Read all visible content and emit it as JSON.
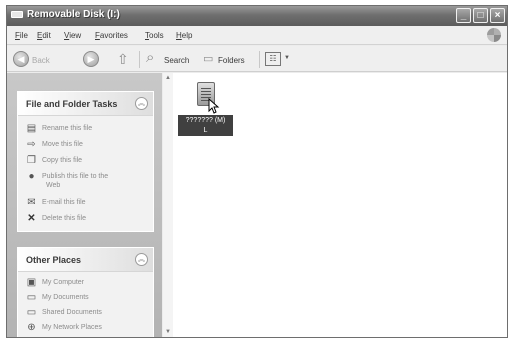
{
  "window": {
    "title": "Removable Disk (I:)"
  },
  "menu": [
    "File",
    "Edit",
    "View",
    "Favorites",
    "Tools",
    "Help"
  ],
  "toolbar": {
    "back": "Back",
    "search": "Search",
    "folders": "Folders"
  },
  "tasks_panel": {
    "title": "File and Folder Tasks",
    "items": [
      {
        "label": "Rename this file",
        "icon": "rename-icon"
      },
      {
        "label": "Move this file",
        "icon": "move-icon"
      },
      {
        "label": "Copy this file",
        "icon": "copy-icon"
      },
      {
        "label": "Publish this file to the",
        "label2": "Web",
        "icon": "publish-icon"
      },
      {
        "label": "E-mail this file",
        "icon": "email-icon"
      },
      {
        "label": "Delete this file",
        "icon": "delete-icon"
      }
    ]
  },
  "places_panel": {
    "title": "Other Places",
    "items": [
      {
        "label": "My Computer",
        "icon": "my-computer-icon"
      },
      {
        "label": "My Documents",
        "icon": "my-documents-icon"
      },
      {
        "label": "Shared Documents",
        "icon": "shared-documents-icon"
      },
      {
        "label": "My Network Places",
        "icon": "network-places-icon"
      }
    ]
  },
  "file": {
    "name_line1": "??????? (M)",
    "name_line2": "L"
  }
}
